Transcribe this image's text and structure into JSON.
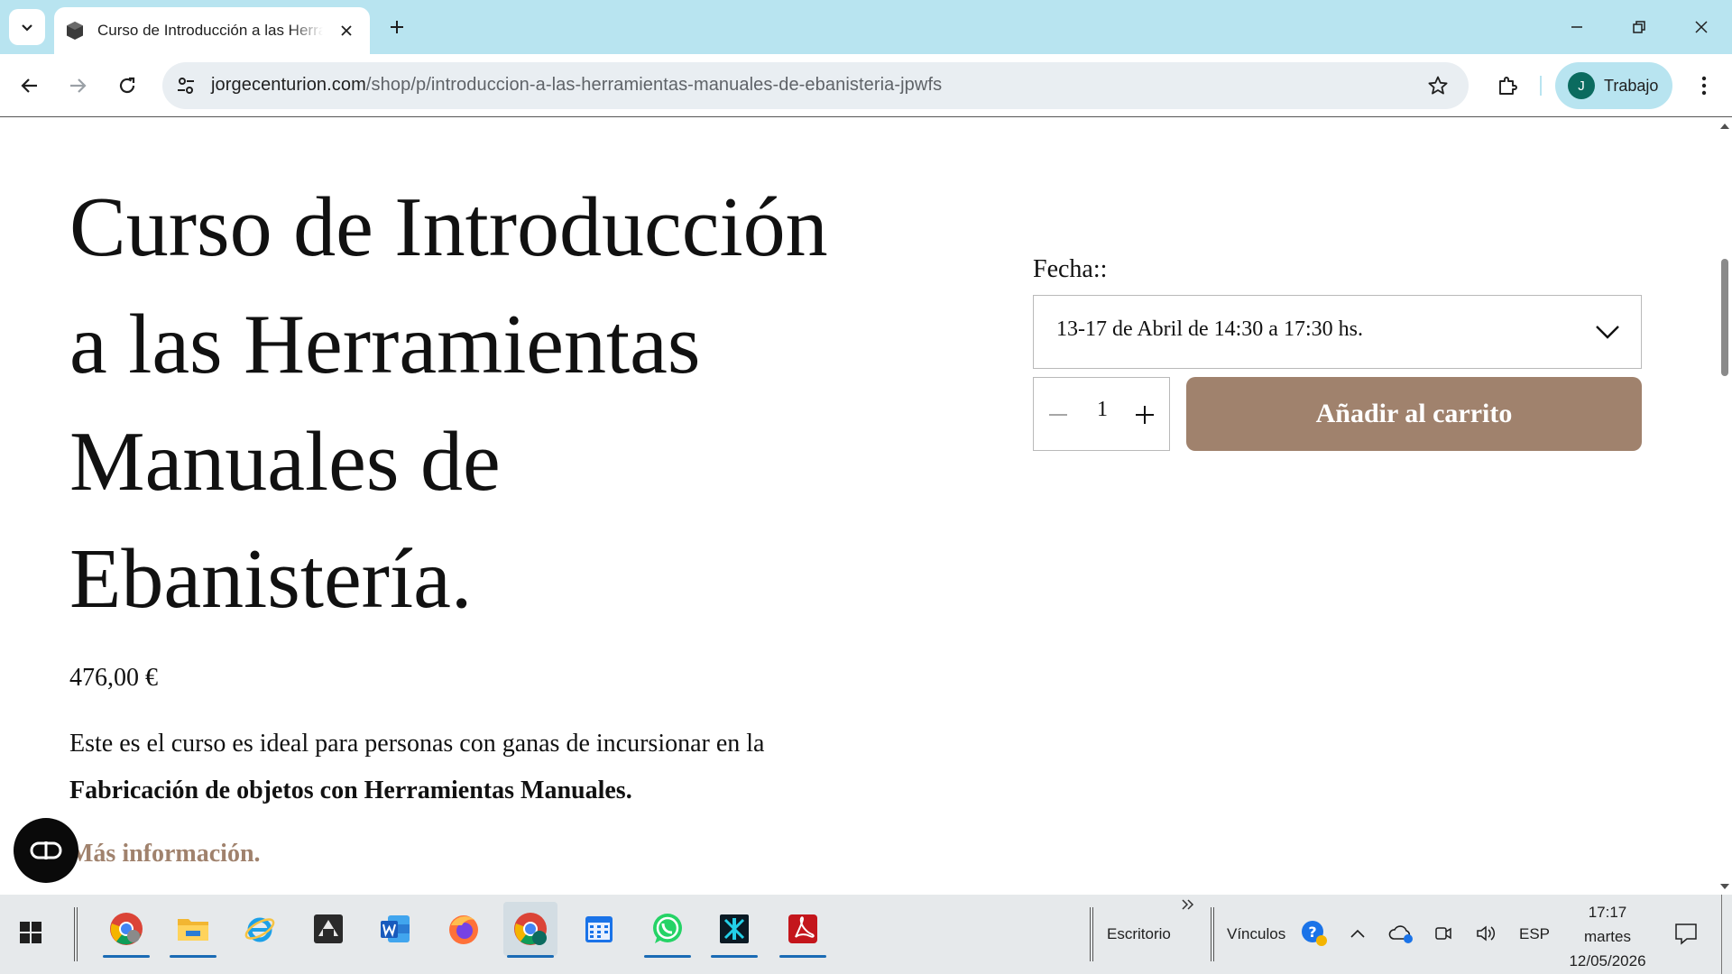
{
  "browser": {
    "tab": {
      "title": "Curso de Introducción a las Herramientas Manuales de Ebanistería",
      "favicon": "cube-icon"
    },
    "url": {
      "host": "jorgecenturion.com",
      "path": "/shop/p/introduccion-a-las-herramientas-manuales-de-ebanisteria-jpwfs"
    },
    "profile": {
      "initial": "J",
      "name": "Trabajo"
    },
    "accent_color": "#b8e4f0"
  },
  "product": {
    "title": "Curso de Introducción a las Herramientas Manuales de Ebanistería.",
    "price": "476,00 €",
    "description_prefix": "Este es el curso es ideal para personas con ganas de incursionar en la",
    "description_bold": "Fabricación de objetos con Herramientas Manuales.",
    "more_info": "Más información.",
    "date_label": "Fecha::",
    "date_selected": "13-17 de Abril de 14:30 a 17:30 hs.",
    "quantity": "1",
    "add_to_cart": "Añadir al carrito",
    "button_color": "#a0826d"
  },
  "taskbar": {
    "apps": [
      "chrome-icon",
      "file-explorer-icon",
      "internet-explorer-icon",
      "app-icon",
      "word-icon",
      "firefox-icon",
      "chrome-profile-icon",
      "calendar-icon",
      "whatsapp-icon",
      "app2-icon",
      "acrobat-icon"
    ],
    "toolbar_desktop": "Escritorio",
    "toolbar_links": "Vínculos",
    "language": "ESP",
    "time": "17:17",
    "day": "martes",
    "date": "12/05/2026"
  }
}
